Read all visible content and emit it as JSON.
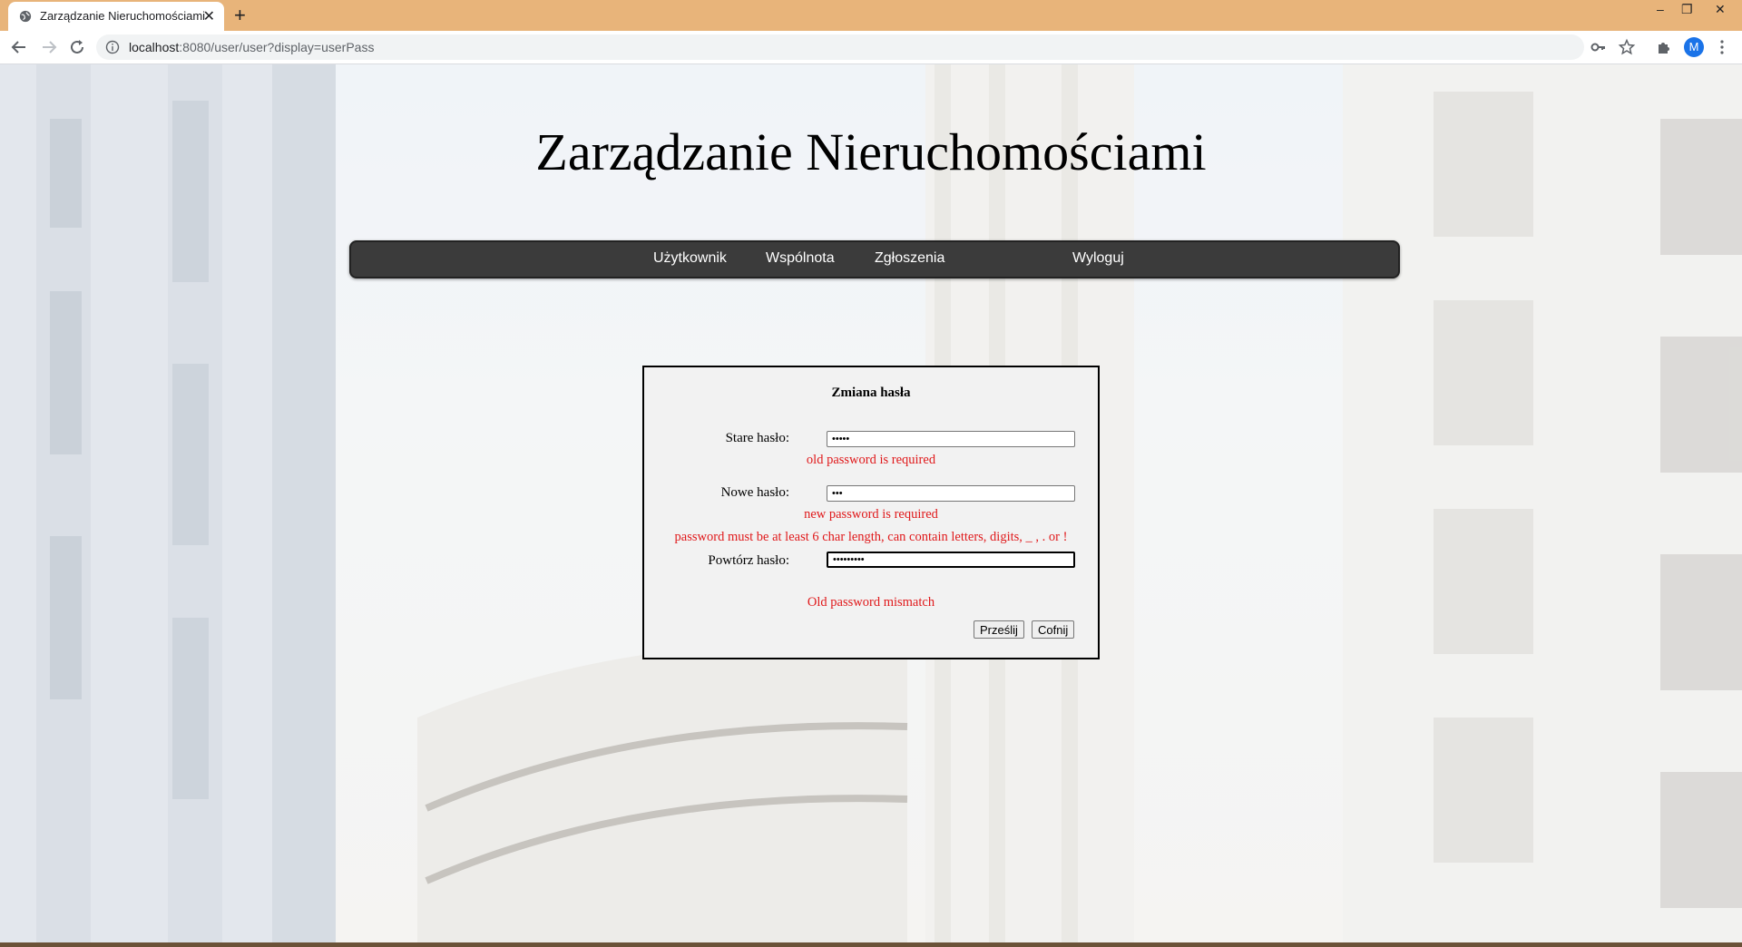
{
  "browser": {
    "tab_title": "Zarządzanie Nieruchomościami",
    "url_host": "localhost",
    "url_rest": ":8080/user/user?display=userPass",
    "avatar_letter": "M",
    "tabbar_color": "#e8b47a"
  },
  "page": {
    "title": "Zarządzanie Nieruchomościami",
    "menu": [
      {
        "label": "Użytkownik"
      },
      {
        "label": "Wspólnota"
      },
      {
        "label": "Zgłoszenia"
      },
      {
        "label": "Wyloguj"
      }
    ]
  },
  "form": {
    "title": "Zmiana hasła",
    "old_label": "Stare hasło:",
    "old_value": "•••••",
    "old_error": "old password is required",
    "new_label": "Nowe hasło:",
    "new_value": "•••",
    "new_error_1": "new password is required",
    "new_error_2": "password must be at least 6 char length, can contain letters, digits, _ , . or !",
    "repeat_label": "Powtórz hasło:",
    "repeat_value": "•••••••••",
    "mismatch_error": "Old password mismatch",
    "submit_label": "Prześlij",
    "back_label": "Cofnij",
    "error_color": "#e0191b"
  }
}
